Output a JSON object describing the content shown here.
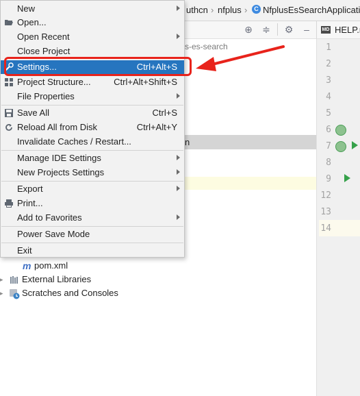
{
  "breadcrumb": {
    "items": [
      "uthcn",
      "nfplus",
      "NfplusEsSearchApplicati"
    ]
  },
  "editor": {
    "tab_label": "HELP.r",
    "line_numbers": [
      "1",
      "2",
      "3",
      "4",
      "5",
      "6",
      "7",
      "8",
      "9",
      "12",
      "13",
      "14"
    ]
  },
  "project_tree": {
    "path_fragment": "s-es-search",
    "selected_row_text": "n",
    "items": [
      {
        "label": "pom.xml",
        "icon": "maven-icon"
      },
      {
        "label": "External Libraries",
        "icon": "library-icon"
      },
      {
        "label": "Scratches and Consoles",
        "icon": "scratches-icon"
      }
    ]
  },
  "file_menu": {
    "items": [
      {
        "label": "New",
        "shortcut": "",
        "submenu": true
      },
      {
        "label": "Open...",
        "shortcut": "",
        "submenu": false,
        "icon": "folder-open-icon"
      },
      {
        "label": "Open Recent",
        "shortcut": "",
        "submenu": true
      },
      {
        "label": "Close Project",
        "shortcut": "",
        "submenu": false
      },
      {
        "label": "Settings...",
        "shortcut": "Ctrl+Alt+S",
        "submenu": false,
        "selected": true,
        "icon": "wrench-icon"
      },
      {
        "label": "Project Structure...",
        "shortcut": "Ctrl+Alt+Shift+S",
        "submenu": false,
        "icon": "project-structure-icon"
      },
      {
        "label": "File Properties",
        "shortcut": "",
        "submenu": true
      },
      {
        "label": "Save All",
        "shortcut": "Ctrl+S",
        "submenu": false,
        "icon": "save-icon"
      },
      {
        "label": "Reload All from Disk",
        "shortcut": "Ctrl+Alt+Y",
        "submenu": false,
        "icon": "reload-icon"
      },
      {
        "label": "Invalidate Caches / Restart...",
        "shortcut": "",
        "submenu": false
      },
      {
        "label": "Manage IDE Settings",
        "shortcut": "",
        "submenu": true
      },
      {
        "label": "New Projects Settings",
        "shortcut": "",
        "submenu": true
      },
      {
        "label": "Export",
        "shortcut": "",
        "submenu": true
      },
      {
        "label": "Print...",
        "shortcut": "",
        "submenu": false,
        "icon": "print-icon"
      },
      {
        "label": "Add to Favorites",
        "shortcut": "",
        "submenu": true
      },
      {
        "label": "Power Save Mode",
        "shortcut": "",
        "submenu": false
      },
      {
        "label": "Exit",
        "shortcut": "",
        "submenu": false
      }
    ]
  },
  "annotations": {
    "highlight_color": "#e8231b"
  },
  "colors": {
    "menu_selection": "#2675bf",
    "menu_background": "#f2f2f2"
  }
}
